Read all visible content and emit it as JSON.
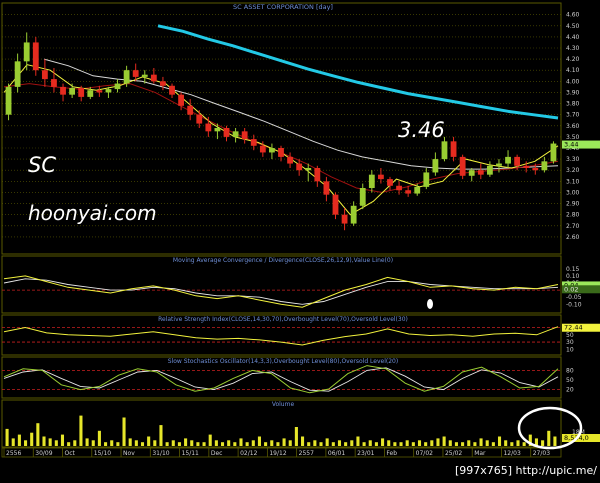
{
  "chart_data": {
    "type": "line",
    "title": "SC ASSET CORPORATION [day]",
    "annotations": {
      "ticker": "SC",
      "site": "hoonyai.com",
      "price_callout": "3.46",
      "footer": "[997x765] http://upic.me/"
    },
    "colors": {
      "background": "#000000",
      "grid": "#5a5a00",
      "bull": "#9acd32",
      "bear": "#e52b1f",
      "ma_long": "#23c9e6",
      "ma_mid": "#d8d8d8",
      "ma_fast": "#a01010",
      "ma_short": "#f2f23d",
      "title_text": "#6f8fd6"
    },
    "price_panel": {
      "ylim": [
        2.5,
        4.66
      ],
      "yticks": [
        "4.60",
        "4.50",
        "4.40",
        "4.30",
        "4.20",
        "4.10",
        "4.00",
        "3.90",
        "3.80",
        "3.70",
        "3.60",
        "3.50",
        "3.40",
        "3.30",
        "3.20",
        "3.10",
        "3.00",
        "2.90",
        "2.80",
        "2.70",
        "2.60"
      ],
      "last_price_label": "3.44",
      "ma_long_label": "3.44",
      "candles": [
        [
          3.7,
          3.98,
          3.65,
          3.95
        ],
        [
          3.95,
          4.25,
          3.9,
          4.18
        ],
        [
          4.18,
          4.44,
          4.1,
          4.35
        ],
        [
          4.35,
          4.4,
          4.05,
          4.1
        ],
        [
          4.1,
          4.2,
          3.95,
          4.02
        ],
        [
          4.02,
          4.12,
          3.9,
          3.95
        ],
        [
          3.95,
          3.98,
          3.82,
          3.88
        ],
        [
          3.88,
          3.98,
          3.85,
          3.94
        ],
        [
          3.94,
          3.96,
          3.82,
          3.86
        ],
        [
          3.86,
          3.95,
          3.84,
          3.92
        ],
        [
          3.92,
          3.96,
          3.86,
          3.9
        ],
        [
          3.9,
          3.95,
          3.85,
          3.93
        ],
        [
          3.93,
          4.02,
          3.9,
          3.98
        ],
        [
          3.98,
          4.14,
          3.95,
          4.1
        ],
        [
          4.1,
          4.16,
          4.0,
          4.04
        ],
        [
          4.04,
          4.1,
          3.98,
          4.06
        ],
        [
          4.06,
          4.12,
          3.98,
          4.0
        ],
        [
          4.0,
          4.04,
          3.92,
          3.96
        ],
        [
          3.96,
          3.98,
          3.85,
          3.88
        ],
        [
          3.88,
          3.9,
          3.74,
          3.78
        ],
        [
          3.78,
          3.84,
          3.65,
          3.7
        ],
        [
          3.7,
          3.74,
          3.58,
          3.62
        ],
        [
          3.62,
          3.68,
          3.5,
          3.55
        ],
        [
          3.55,
          3.62,
          3.48,
          3.58
        ],
        [
          3.58,
          3.6,
          3.46,
          3.5
        ],
        [
          3.5,
          3.58,
          3.45,
          3.55
        ],
        [
          3.55,
          3.58,
          3.44,
          3.48
        ],
        [
          3.48,
          3.52,
          3.38,
          3.42
        ],
        [
          3.42,
          3.46,
          3.32,
          3.36
        ],
        [
          3.36,
          3.44,
          3.3,
          3.4
        ],
        [
          3.4,
          3.42,
          3.28,
          3.32
        ],
        [
          3.32,
          3.36,
          3.22,
          3.26
        ],
        [
          3.26,
          3.3,
          3.15,
          3.2
        ],
        [
          3.2,
          3.26,
          3.1,
          3.22
        ],
        [
          3.22,
          3.24,
          3.05,
          3.1
        ],
        [
          3.1,
          3.14,
          2.92,
          2.98
        ],
        [
          2.98,
          3.0,
          2.76,
          2.8
        ],
        [
          2.8,
          2.86,
          2.66,
          2.72
        ],
        [
          2.72,
          2.92,
          2.7,
          2.88
        ],
        [
          2.88,
          3.08,
          2.85,
          3.04
        ],
        [
          3.04,
          3.2,
          3.0,
          3.16
        ],
        [
          3.16,
          3.22,
          3.08,
          3.12
        ],
        [
          3.12,
          3.14,
          3.02,
          3.06
        ],
        [
          3.06,
          3.1,
          2.98,
          3.02
        ],
        [
          3.02,
          3.06,
          2.96,
          2.99
        ],
        [
          2.99,
          3.08,
          2.97,
          3.05
        ],
        [
          3.05,
          3.22,
          3.03,
          3.18
        ],
        [
          3.18,
          3.36,
          3.15,
          3.3
        ],
        [
          3.3,
          3.5,
          3.28,
          3.46
        ],
        [
          3.46,
          3.5,
          3.28,
          3.32
        ],
        [
          3.32,
          3.34,
          3.12,
          3.15
        ],
        [
          3.15,
          3.22,
          3.1,
          3.2
        ],
        [
          3.2,
          3.26,
          3.12,
          3.16
        ],
        [
          3.16,
          3.28,
          3.14,
          3.24
        ],
        [
          3.24,
          3.3,
          3.18,
          3.26
        ],
        [
          3.26,
          3.38,
          3.22,
          3.32
        ],
        [
          3.32,
          3.34,
          3.2,
          3.24
        ],
        [
          3.24,
          3.28,
          3.18,
          3.22
        ],
        [
          3.22,
          3.26,
          3.16,
          3.2
        ],
        [
          3.2,
          3.32,
          3.18,
          3.28
        ],
        [
          3.28,
          3.46,
          3.26,
          3.44
        ]
      ],
      "ma_long": [
        4.5,
        4.45,
        4.38,
        4.32,
        4.25,
        4.18,
        4.11,
        4.05,
        3.99,
        3.94,
        3.89,
        3.85,
        3.81,
        3.77,
        3.73,
        3.7,
        3.67
      ],
      "ma_mid": [
        4.2,
        4.14,
        4.05,
        4.02,
        4.0,
        3.94,
        3.88,
        3.8,
        3.72,
        3.64,
        3.55,
        3.46,
        3.38,
        3.32,
        3.28,
        3.24,
        3.22,
        3.21,
        3.21,
        3.22,
        3.23,
        3.24
      ],
      "ma_fast": [
        3.95,
        3.98,
        3.95,
        3.93,
        3.96,
        3.98,
        3.9,
        3.78,
        3.66,
        3.55,
        3.45,
        3.36,
        3.26,
        3.14,
        3.04,
        3.0,
        3.05,
        3.12,
        3.17,
        3.19,
        3.21,
        3.24,
        3.28
      ],
      "ma_short": [
        3.9,
        4.15,
        4.1,
        3.95,
        3.92,
        3.96,
        4.04,
        3.98,
        3.8,
        3.62,
        3.5,
        3.45,
        3.36,
        3.22,
        3.05,
        2.8,
        2.92,
        3.12,
        3.05,
        3.1,
        3.3,
        3.25,
        3.22,
        3.28,
        3.42
      ]
    },
    "macd_panel": {
      "title": "Moving Average Convergence / Divergence(CLOSE,26,12,9),Value Line(0)",
      "yticks": [
        "0.15",
        "0.10",
        "0.05",
        "0.00",
        "-0.05",
        "-0.10"
      ],
      "ylim": [
        -0.14,
        0.17
      ],
      "labels": [
        "0.04",
        "0.02"
      ],
      "macd": [
        0.08,
        0.1,
        0.06,
        0.02,
        0.0,
        -0.02,
        0.01,
        0.03,
        0.0,
        -0.04,
        -0.06,
        -0.04,
        -0.07,
        -0.1,
        -0.12,
        -0.06,
        0.0,
        0.04,
        0.09,
        0.06,
        0.02,
        0.03,
        0.01,
        0.0,
        0.02,
        0.01,
        0.04
      ],
      "signal": [
        0.05,
        0.08,
        0.07,
        0.04,
        0.02,
        0.0,
        0.0,
        0.02,
        0.01,
        -0.02,
        -0.04,
        -0.04,
        -0.05,
        -0.08,
        -0.1,
        -0.08,
        -0.03,
        0.02,
        0.06,
        0.06,
        0.04,
        0.03,
        0.02,
        0.01,
        0.01,
        0.01,
        0.02
      ],
      "value_line": 0.0
    },
    "rsi_panel": {
      "title": "Relative Strength Index(CLOSE,14,30,70),Overbought Level(70),Oversold Level(30)",
      "yticks": [
        "70",
        "50",
        "30",
        "10"
      ],
      "ylim": [
        0,
        85
      ],
      "overbought": 70,
      "oversold": 30,
      "last_label": "72.44",
      "rsi": [
        58,
        70,
        55,
        50,
        48,
        46,
        52,
        58,
        50,
        42,
        38,
        40,
        36,
        30,
        22,
        35,
        45,
        52,
        66,
        52,
        48,
        50,
        46,
        52,
        54,
        50,
        72
      ]
    },
    "stoch_panel": {
      "title": "Slow Stochastics Oscillator(14,3,3),Overbought Level(80),Oversold Level(20)",
      "yticks": [
        "80",
        "50",
        "20"
      ],
      "ylim": [
        0,
        100
      ],
      "overbought": 80,
      "oversold": 20,
      "k": [
        60,
        85,
        80,
        35,
        20,
        30,
        65,
        85,
        75,
        35,
        15,
        25,
        55,
        80,
        70,
        25,
        10,
        22,
        70,
        95,
        85,
        40,
        15,
        30,
        75,
        90,
        60,
        25,
        30,
        85
      ],
      "d": [
        55,
        75,
        82,
        55,
        30,
        25,
        50,
        75,
        80,
        55,
        28,
        20,
        40,
        70,
        75,
        45,
        18,
        15,
        45,
        80,
        88,
        62,
        28,
        20,
        55,
        82,
        72,
        42,
        28,
        60
      ]
    },
    "volume_panel": {
      "title": "Volume",
      "ytick": "18M",
      "last_label": "8,534,0",
      "volumes": [
        9,
        4,
        6,
        3,
        7,
        12,
        5,
        4,
        3,
        6,
        2,
        3,
        16,
        4,
        3,
        8,
        2,
        3,
        2,
        15,
        4,
        3,
        2,
        5,
        3,
        11,
        2,
        3,
        2,
        4,
        3,
        2,
        2,
        6,
        3,
        2,
        3,
        2,
        4,
        2,
        3,
        5,
        2,
        3,
        2,
        4,
        3,
        10,
        5,
        2,
        3,
        2,
        4,
        2,
        3,
        2,
        3,
        5,
        2,
        3,
        2,
        4,
        3,
        2,
        2,
        3,
        2,
        3,
        2,
        3,
        4,
        5,
        3,
        2,
        2,
        3,
        2,
        4,
        3,
        2,
        5,
        3,
        2,
        3,
        2,
        6,
        4,
        3,
        8,
        5
      ]
    },
    "x_axis": {
      "labels": [
        "2556",
        "30/09",
        "Oct",
        "15/10",
        "Nov",
        "31/10",
        "15/11",
        "Dec",
        "02/12",
        "19/12",
        "2557",
        "06/01",
        "23/01",
        "Feb",
        "07/02",
        "25/02",
        "Mar",
        "12/03",
        "27/03"
      ]
    }
  }
}
